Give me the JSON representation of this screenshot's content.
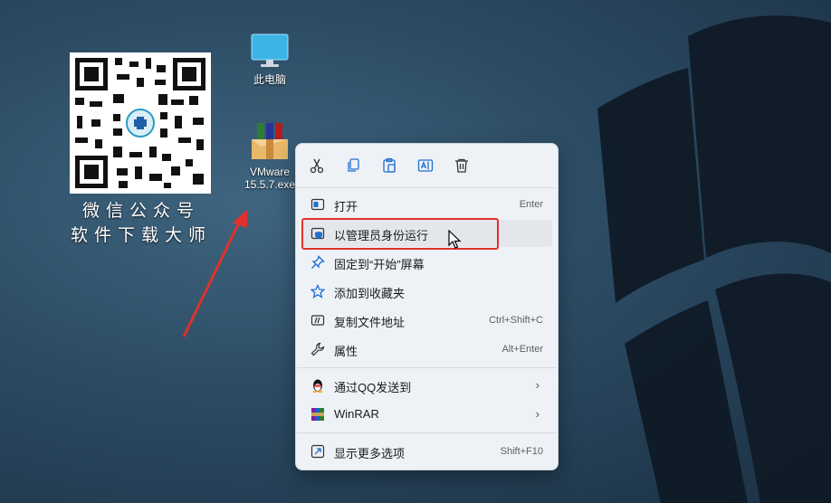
{
  "desktop": {
    "qr_caption_line1": "微信公众号",
    "qr_caption_line2": "软件下载大师",
    "icons": [
      {
        "name": "此电脑"
      },
      {
        "name_line1": "VMware",
        "name_line2": "15.5.7.exe"
      }
    ]
  },
  "context_menu": {
    "items": [
      {
        "label": "打开",
        "shortcut": "Enter"
      },
      {
        "label": "以管理员身份运行",
        "shortcut": ""
      },
      {
        "label": "固定到“开始”屏幕",
        "shortcut": ""
      },
      {
        "label": "添加到收藏夹",
        "shortcut": ""
      },
      {
        "label": "复制文件地址",
        "shortcut": "Ctrl+Shift+C"
      },
      {
        "label": "属性",
        "shortcut": "Alt+Enter"
      },
      {
        "label": "通过QQ发送到",
        "shortcut": ""
      },
      {
        "label": "WinRAR",
        "shortcut": ""
      },
      {
        "label": "显示更多选项",
        "shortcut": "Shift+F10"
      }
    ],
    "toolbar_icons": [
      "cut-icon",
      "copy-icon",
      "paste-icon",
      "rename-icon",
      "delete-icon"
    ]
  },
  "colors": {
    "accent": "#1f6fd1",
    "highlight_box": "#e0312c",
    "arrow": "#e0312c"
  }
}
